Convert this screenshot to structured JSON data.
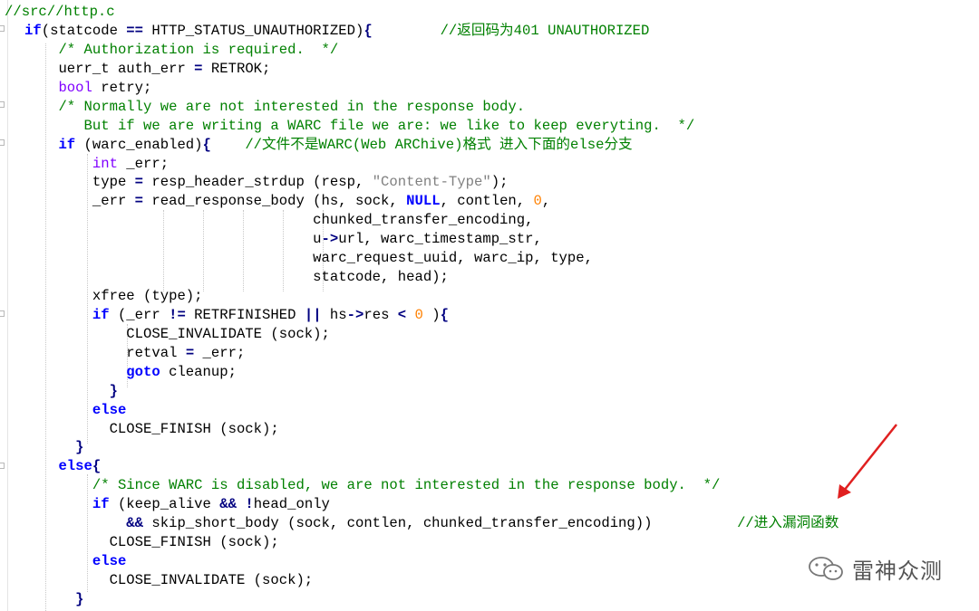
{
  "editor": {
    "file_path_comment": "//src//http.c",
    "lines": [
      {
        "indent": "",
        "parts": [
          [
            "kw",
            "if"
          ],
          [
            "",
            "(statcode "
          ],
          [
            "op",
            "=="
          ],
          [
            "",
            " HTTP_STATUS_UNAUTHORIZED)"
          ],
          [
            "op",
            "{"
          ],
          [
            "",
            "        "
          ],
          [
            "cm",
            "//返回码为401 UNAUTHORIZED"
          ]
        ]
      },
      {
        "indent": "    ",
        "parts": [
          [
            "cm",
            "/* Authorization is required.  */"
          ]
        ]
      },
      {
        "indent": "    ",
        "parts": [
          [
            "",
            "uerr_t auth_err "
          ],
          [
            "op",
            "="
          ],
          [
            "",
            " RETROK;"
          ]
        ]
      },
      {
        "indent": "    ",
        "parts": [
          [
            "ty",
            "bool"
          ],
          [
            "",
            " retry;"
          ]
        ]
      },
      {
        "indent": "    ",
        "parts": [
          [
            "cm",
            "/* Normally we are not interested in the response body."
          ]
        ]
      },
      {
        "indent": "       ",
        "parts": [
          [
            "cm",
            "But if we are writing a WARC file we are: we like to keep everyting.  */"
          ]
        ]
      },
      {
        "indent": "    ",
        "parts": [
          [
            "kw",
            "if"
          ],
          [
            "",
            " (warc_enabled)"
          ],
          [
            "op",
            "{"
          ],
          [
            "",
            "    "
          ],
          [
            "cm",
            "//文件不是WARC(Web ARChive)格式 进入下面的else分支"
          ]
        ]
      },
      {
        "indent": "        ",
        "parts": [
          [
            "ty",
            "int"
          ],
          [
            "",
            " _err;"
          ]
        ]
      },
      {
        "indent": "        ",
        "parts": [
          [
            "",
            "type "
          ],
          [
            "op",
            "="
          ],
          [
            "",
            " resp_header_strdup (resp, "
          ],
          [
            "str",
            "\"Content-Type\""
          ],
          [
            "",
            "); "
          ]
        ]
      },
      {
        "indent": "        ",
        "parts": [
          [
            "",
            "_err "
          ],
          [
            "op",
            "="
          ],
          [
            "",
            " read_response_body (hs, sock, "
          ],
          [
            "kw",
            "NULL"
          ],
          [
            "",
            ", contlen, "
          ],
          [
            "num",
            "0"
          ],
          [
            "",
            ","
          ]
        ]
      },
      {
        "indent": "                                  ",
        "parts": [
          [
            "",
            "chunked_transfer_encoding,"
          ]
        ]
      },
      {
        "indent": "                                  ",
        "parts": [
          [
            "",
            "u"
          ],
          [
            "op",
            "->"
          ],
          [
            "",
            "url, warc_timestamp_str,"
          ]
        ]
      },
      {
        "indent": "                                  ",
        "parts": [
          [
            "",
            "warc_request_uuid, warc_ip, type,"
          ]
        ]
      },
      {
        "indent": "                                  ",
        "parts": [
          [
            "",
            "statcode, head);"
          ]
        ]
      },
      {
        "indent": "        ",
        "parts": [
          [
            "",
            "xfree (type);"
          ]
        ]
      },
      {
        "indent": "        ",
        "parts": [
          [
            "kw",
            "if"
          ],
          [
            "",
            " (_err "
          ],
          [
            "op",
            "!="
          ],
          [
            "",
            " RETRFINISHED "
          ],
          [
            "op",
            "||"
          ],
          [
            "",
            " hs"
          ],
          [
            "op",
            "->"
          ],
          [
            "",
            "res "
          ],
          [
            "op",
            "<"
          ],
          [
            "",
            " "
          ],
          [
            "num",
            "0"
          ],
          [
            "",
            " )"
          ],
          [
            "op",
            "{"
          ]
        ]
      },
      {
        "indent": "            ",
        "parts": [
          [
            "",
            "CLOSE_INVALIDATE (sock);"
          ]
        ]
      },
      {
        "indent": "            ",
        "parts": [
          [
            "",
            "retval "
          ],
          [
            "op",
            "="
          ],
          [
            "",
            " _err;"
          ]
        ]
      },
      {
        "indent": "            ",
        "parts": [
          [
            "kw",
            "goto"
          ],
          [
            "",
            " cleanup;"
          ]
        ]
      },
      {
        "indent": "          ",
        "parts": [
          [
            "op",
            "}"
          ]
        ]
      },
      {
        "indent": "        ",
        "parts": [
          [
            "kw",
            "else"
          ]
        ]
      },
      {
        "indent": "          ",
        "parts": [
          [
            "",
            "CLOSE_FINISH (sock);"
          ]
        ]
      },
      {
        "indent": "      ",
        "parts": [
          [
            "op",
            "}"
          ]
        ]
      },
      {
        "indent": "    ",
        "parts": [
          [
            "kw",
            "else"
          ],
          [
            "op",
            "{"
          ]
        ]
      },
      {
        "indent": "        ",
        "parts": [
          [
            "cm",
            "/* Since WARC is disabled, we are not interested in the response body.  */"
          ]
        ]
      },
      {
        "indent": "        ",
        "parts": [
          [
            "kw",
            "if"
          ],
          [
            "",
            " (keep_alive "
          ],
          [
            "op",
            "&&"
          ],
          [
            "",
            " "
          ],
          [
            "op",
            "!"
          ],
          [
            "",
            "head_only"
          ]
        ]
      },
      {
        "indent": "            ",
        "parts": [
          [
            "op",
            "&&"
          ],
          [
            "",
            " skip_short_body (sock, contlen, chunked_transfer_encoding))          "
          ],
          [
            "cm",
            "//进入漏洞函数"
          ]
        ]
      },
      {
        "indent": "          ",
        "parts": [
          [
            "",
            "CLOSE_FINISH (sock);"
          ]
        ]
      },
      {
        "indent": "        ",
        "parts": [
          [
            "kw",
            "else"
          ]
        ]
      },
      {
        "indent": "          ",
        "parts": [
          [
            "",
            "CLOSE_INVALIDATE (sock);"
          ]
        ]
      },
      {
        "indent": "      ",
        "parts": [
          [
            "op",
            "}"
          ]
        ]
      }
    ]
  },
  "watermark": {
    "text": "雷神众测",
    "icon": "wechat-icon"
  },
  "colors": {
    "keyword": "#0000ff",
    "type": "#8000ff",
    "comment": "#008000",
    "string": "#808080",
    "number": "#ff8000",
    "operator": "#000080",
    "arrow": "#e02020"
  }
}
